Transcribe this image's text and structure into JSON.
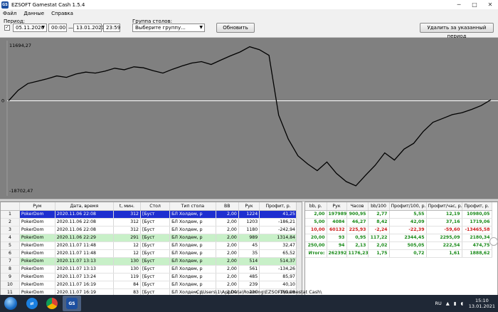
{
  "window": {
    "title": "EZSOFT Gamestat Cash 1.5.4",
    "icon": "GS"
  },
  "menu": [
    "Файл",
    "Данные",
    "Справка"
  ],
  "toolbar": {
    "period_label": "Период:",
    "date_from": "05.11.2020",
    "time_from": "00:00",
    "dash": "—",
    "date_to": "13.01.2021",
    "time_to": "23:59",
    "group_label": "Группа столов:",
    "group_select": "Выберите группу...",
    "refresh_label": "Обновить",
    "delete_label": "Удалить за указанный период"
  },
  "chart_data": {
    "type": "line",
    "y_max_label": "11694,27",
    "y_zero_label": "0",
    "y_min_label": "-18702,47",
    "ylim": [
      -18702.47,
      11694.27
    ],
    "x": [
      0,
      2,
      4,
      6,
      8,
      10,
      12,
      14,
      16,
      18,
      20,
      22,
      24,
      26,
      28,
      30,
      32,
      34,
      36,
      38,
      40,
      42,
      44,
      46,
      48,
      50,
      52,
      54,
      56,
      58,
      60,
      62,
      64,
      66,
      68,
      70,
      72,
      74,
      76,
      78,
      80,
      82,
      84,
      86,
      88,
      90,
      92,
      94,
      96,
      98,
      100
    ],
    "values": [
      0,
      2200,
      3600,
      4100,
      4600,
      5200,
      4900,
      5600,
      6000,
      5800,
      6200,
      6800,
      6500,
      7100,
      6900,
      6300,
      5800,
      6600,
      7300,
      7900,
      8200,
      7600,
      8500,
      9400,
      10200,
      11300,
      10700,
      9500,
      -3000,
      -8000,
      -11500,
      -13200,
      -14600,
      -12800,
      -15200,
      -16900,
      -17800,
      -15600,
      -13500,
      -10900,
      -12400,
      -10100,
      -8900,
      -6400,
      -4500,
      -3700,
      -2900,
      -2500,
      -1800,
      -1000,
      200
    ]
  },
  "left_table": {
    "headers": [
      "",
      "Рум",
      "Дата, время",
      "t, мин.",
      "Стол",
      "Тип стола",
      "BB",
      "Рук",
      "Профит, р."
    ],
    "rows": [
      [
        "1",
        "PokerDom",
        "2020.11.06  22:08",
        "312",
        "[Буст",
        "БЛ Холдем, р",
        "2,00",
        "1224",
        "41,25"
      ],
      [
        "2",
        "PokerDom",
        "2020.11.06  22:08",
        "312",
        "[Буст",
        "БЛ Холдем, р",
        "2,00",
        "1203",
        "-186,21"
      ],
      [
        "3",
        "PokerDom",
        "2020.11.06  22:08",
        "312",
        "[Буст",
        "БЛ Холдем, р",
        "2,00",
        "1180",
        "-242,94"
      ],
      [
        "4",
        "PokerDom",
        "2020.11.06  22:29",
        "291",
        "[Буст",
        "БЛ Холдем, р",
        "2,00",
        "989",
        "1314,84"
      ],
      [
        "5",
        "PokerDom",
        "2020.11.07  11:48",
        "12",
        "[Буст",
        "БЛ Холдем, р",
        "2,00",
        "45",
        "32,47"
      ],
      [
        "6",
        "PokerDom",
        "2020.11.07  11:48",
        "12",
        "[Буст",
        "БЛ Холдем, р",
        "2,00",
        "35",
        "65,52"
      ],
      [
        "7",
        "PokerDom",
        "2020.11.07  13:13",
        "130",
        "[Буст",
        "БЛ Холдем, р",
        "2,00",
        "514",
        "514,37"
      ],
      [
        "8",
        "PokerDom",
        "2020.11.07  13:13",
        "130",
        "[Буст",
        "БЛ Холдем, р",
        "2,00",
        "561",
        "-134,26"
      ],
      [
        "9",
        "PokerDom",
        "2020.11.07  13:24",
        "119",
        "[Буст",
        "БЛ Холдем, р",
        "2,00",
        "485",
        "85,97"
      ],
      [
        "10",
        "PokerDom",
        "2020.11.07  16:19",
        "84",
        "[Буст",
        "БЛ Холдем, р",
        "2,00",
        "239",
        "40,10"
      ],
      [
        "11",
        "PokerDom",
        "2020.11.07  16:19",
        "83",
        "[Буст",
        "БЛ Холдем, р",
        "2,00",
        "220",
        "-169,98"
      ]
    ]
  },
  "right_table": {
    "headers": [
      "bb, р.",
      "Рук",
      "Часов",
      "bb/100",
      "Профит/100, р.",
      "Профит/час, р.",
      "Профит, р."
    ],
    "rows": [
      {
        "cls": "g",
        "cells": [
          "2,00",
          "197989",
          "900,95",
          "2,77",
          "5,55",
          "12,19",
          "10980,05"
        ]
      },
      {
        "cls": "g",
        "cells": [
          "5,00",
          "4084",
          "46,27",
          "8,42",
          "42,09",
          "37,16",
          "1719,06"
        ]
      },
      {
        "cls": "r",
        "cells": [
          "10,00",
          "60132",
          "225,93",
          "-2,24",
          "-22,39",
          "-59,60",
          "-13465,58"
        ]
      },
      {
        "cls": "g",
        "cells": [
          "20,00",
          "93",
          "0,95",
          "117,22",
          "2344,45",
          "2295,09",
          "2180,34"
        ]
      },
      {
        "cls": "g",
        "cells": [
          "250,00",
          "94",
          "2,13",
          "2,02",
          "505,05",
          "222,54",
          "474,75"
        ]
      },
      {
        "cls": "t",
        "cells": [
          "Итого:",
          "262392",
          "1176,23",
          "1,75",
          "0,72",
          "1,61",
          "1888,62"
        ]
      }
    ]
  },
  "status": {
    "path": "C:\\Users\\1\\AppData\\Roaming\\EZSOFT\\Gamestat Cash\\"
  },
  "tray": {
    "lang": "RU",
    "time": "15:10",
    "date": "13.01.2021"
  }
}
